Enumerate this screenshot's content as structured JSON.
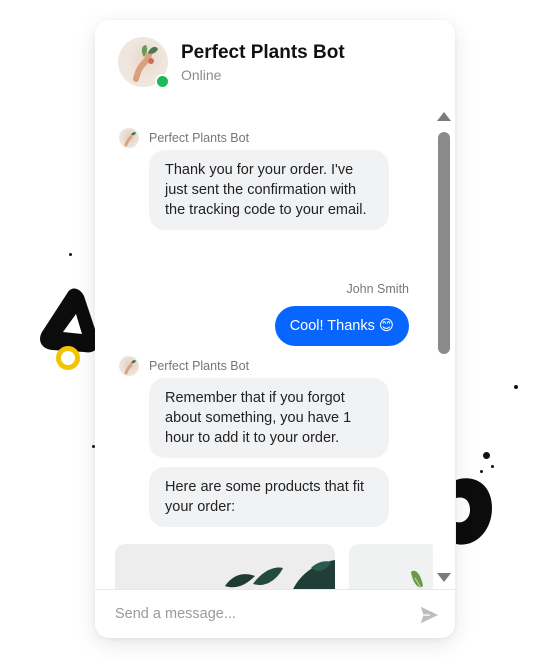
{
  "header": {
    "bot_name": "Perfect Plants Bot",
    "status": "Online",
    "status_color": "#1db954"
  },
  "messages": [
    {
      "sender": "Perfect Plants Bot",
      "bubbles": [
        "Thank you for your order. I've just sent the confirmation with the tracking code to your email."
      ]
    },
    {
      "sender": "John Smith",
      "bubbles": [
        "Cool! Thanks 😊"
      ]
    },
    {
      "sender": "Perfect Plants Bot",
      "bubbles": [
        "Remember that if you forgot about something, you have 1 hour to add it to your order.",
        "Here are some products that fit your order:"
      ]
    }
  ],
  "composer": {
    "placeholder": "Send a message...",
    "send_icon": "send-icon"
  },
  "colors": {
    "user_bubble": "#0866ff",
    "bot_bubble": "#f1f2f4",
    "decor_yellow": "#f5c400"
  }
}
